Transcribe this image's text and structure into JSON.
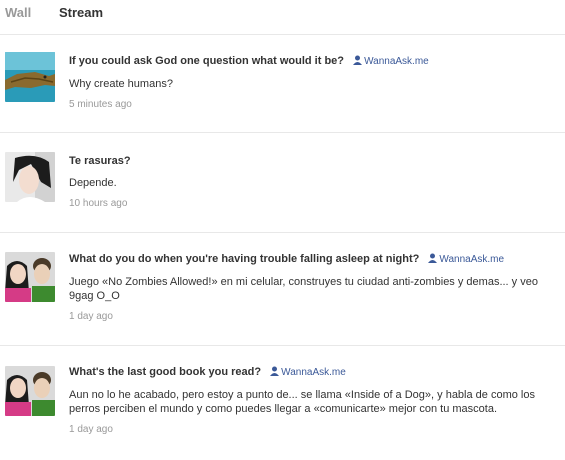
{
  "tabs": {
    "wall": "Wall",
    "stream": "Stream"
  },
  "via_label": "WannaAsk.me",
  "items": [
    {
      "question": "If you could ask God one question what would it be?",
      "answer": "Why create humans?",
      "time": "5 minutes ago",
      "avatar": "crocodile-avatar",
      "has_via": true
    },
    {
      "question": "Te rasuras?",
      "answer": "Depende.",
      "time": "10 hours ago",
      "avatar": "girl-avatar",
      "has_via": false
    },
    {
      "question": "What do you do when you're having trouble falling asleep at night?",
      "answer": "Juego «No Zombies Allowed!» en mi celular, construyes tu ciudad anti-zombies y demas... y veo 9gag O_O",
      "time": "1 day ago",
      "avatar": "couple-avatar",
      "has_via": true
    },
    {
      "question": "What's the last good book you read?",
      "answer": "Aun no lo he acabado, pero estoy a punto de... se llama «Inside of a Dog», y habla de como los perros perciben el mundo y como puedes llegar a «comunicarte» mejor con tu mascota.",
      "time": "1 day ago",
      "avatar": "couple-avatar",
      "has_via": true
    }
  ],
  "colors": {
    "link": "#3b5998",
    "muted": "#999999",
    "text": "#333333",
    "divider": "#e8e8e8"
  }
}
